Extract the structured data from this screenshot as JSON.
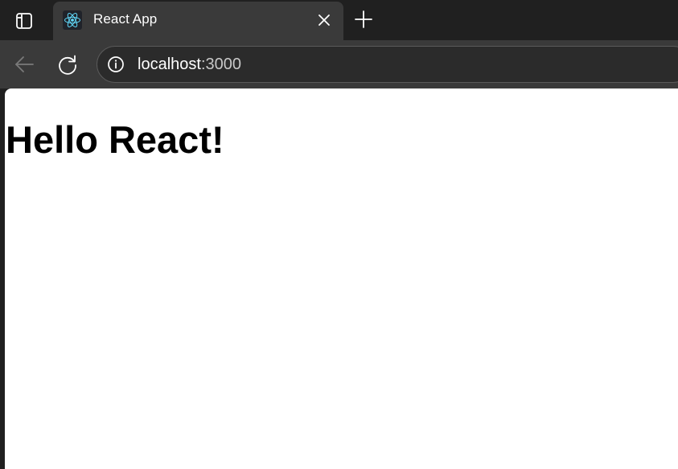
{
  "tab": {
    "title": "React App",
    "favicon": "react-logo-icon"
  },
  "toolbar": {
    "url_host": "localhost",
    "url_port": ":3000",
    "back_icon": "back-arrow-icon",
    "reload_icon": "reload-icon",
    "site_info_icon": "info-icon"
  },
  "page": {
    "heading": "Hello React!"
  },
  "colors": {
    "chrome_bg": "#202020",
    "toolbar_bg": "#3a3a3a",
    "react_blue": "#61dafb"
  }
}
